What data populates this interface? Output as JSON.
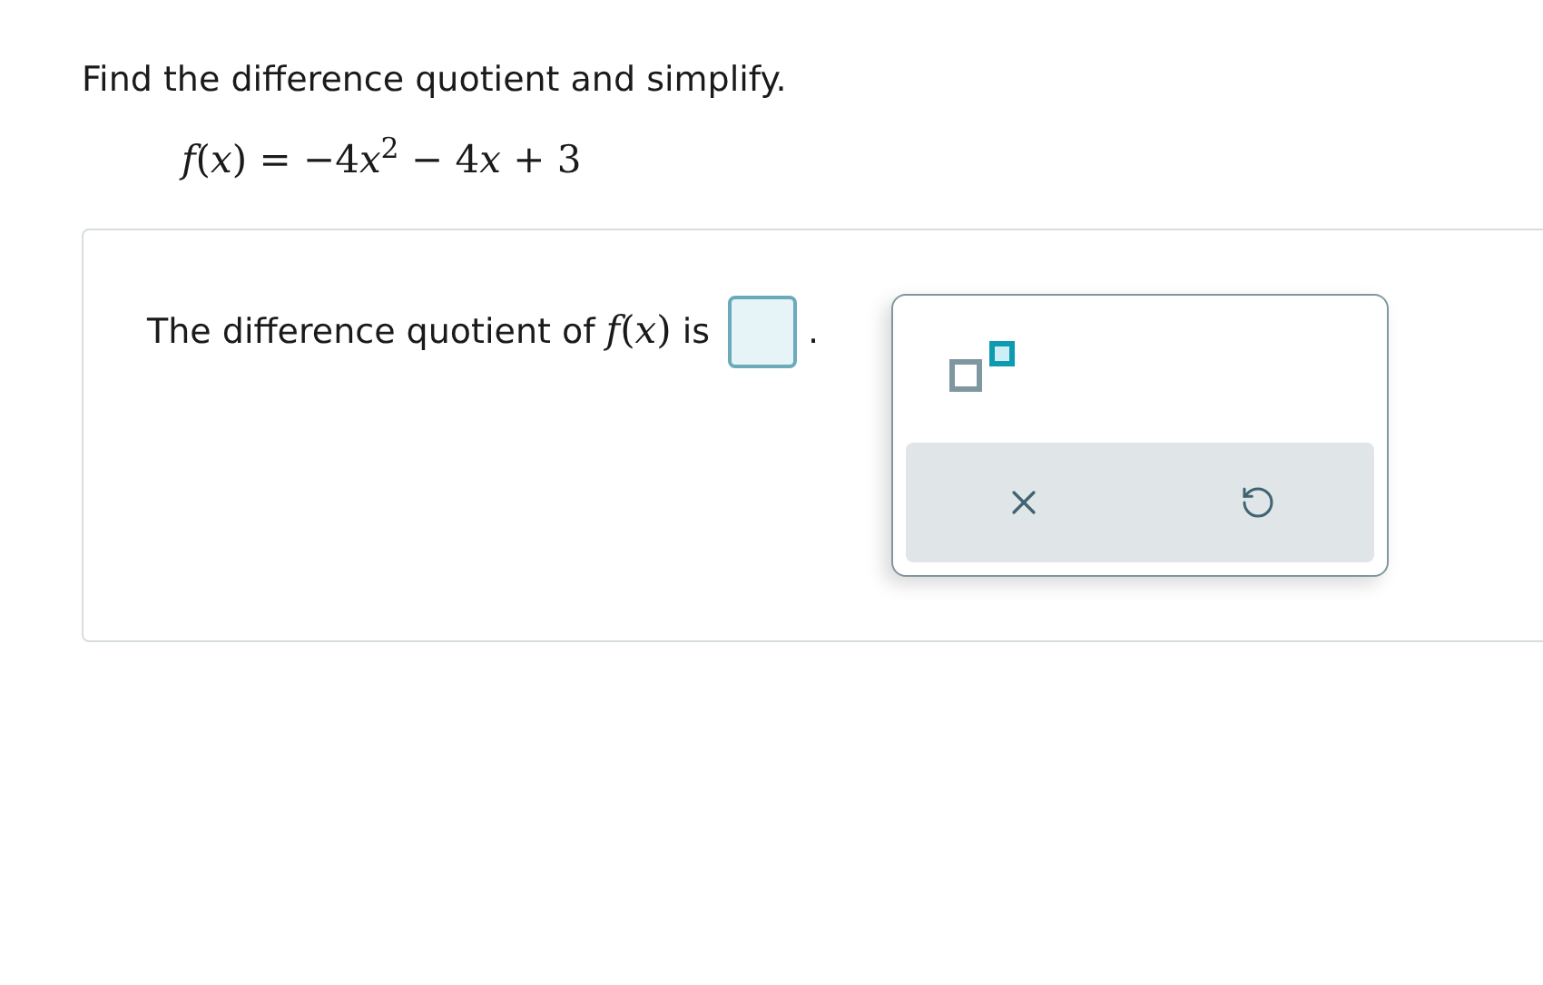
{
  "instruction": "Find the difference quotient and simplify.",
  "function": [
    {
      "kind": "var",
      "text": "f"
    },
    {
      "kind": "sym",
      "text": "("
    },
    {
      "kind": "var",
      "text": "x"
    },
    {
      "kind": "sym",
      "text": ") = −4"
    },
    {
      "kind": "var",
      "text": "x"
    },
    {
      "kind": "sup",
      "text": "2"
    },
    {
      "kind": "sym",
      "text": " − 4"
    },
    {
      "kind": "var",
      "text": "x"
    },
    {
      "kind": "sym",
      "text": " + 3"
    }
  ],
  "answer": {
    "prompt_before": "The difference quotient of",
    "prompt_math": [
      {
        "kind": "var",
        "text": "f"
      },
      {
        "kind": "sym",
        "text": "("
      },
      {
        "kind": "var",
        "text": "x"
      },
      {
        "kind": "sym",
        "text": ")"
      }
    ],
    "prompt_after": "is",
    "end_mark": "."
  },
  "palette": {
    "tools": [
      {
        "kind": "exponent"
      }
    ],
    "actions": [
      {
        "kind": "clear"
      },
      {
        "kind": "undo"
      }
    ]
  }
}
